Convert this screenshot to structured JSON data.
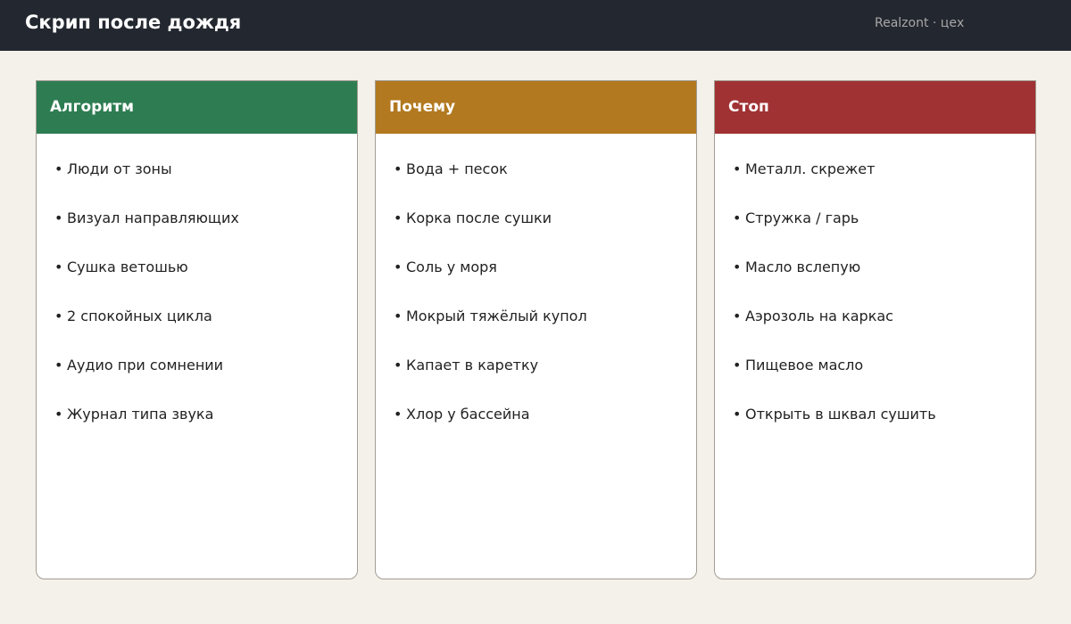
{
  "header": {
    "title": "Скрип после дождя",
    "subtitle": "Realzont · цех"
  },
  "colors": {
    "topbar": "#23272f",
    "background": "#f4f1ea",
    "algorithm": "#2e7d52",
    "why": "#b27920",
    "stop": "#a03234"
  },
  "cards": [
    {
      "title": "Алгоритм",
      "items": [
        "Люди от зоны",
        "Визуал направляющих",
        "Сушка ветошью",
        "2 спокойных цикла",
        "Аудио при сомнении",
        "Журнал типа звука"
      ]
    },
    {
      "title": "Почему",
      "items": [
        "Вода + песок",
        "Корка после сушки",
        "Соль у моря",
        "Мокрый тяжёлый купол",
        "Капает в каретку",
        "Хлор у бассейна"
      ]
    },
    {
      "title": "Стоп",
      "items": [
        "Металл. скрежет",
        "Стружка / гарь",
        "Масло вслепую",
        "Аэрозоль на каркас",
        "Пищевое масло",
        "Открыть в шквал сушить"
      ]
    }
  ]
}
